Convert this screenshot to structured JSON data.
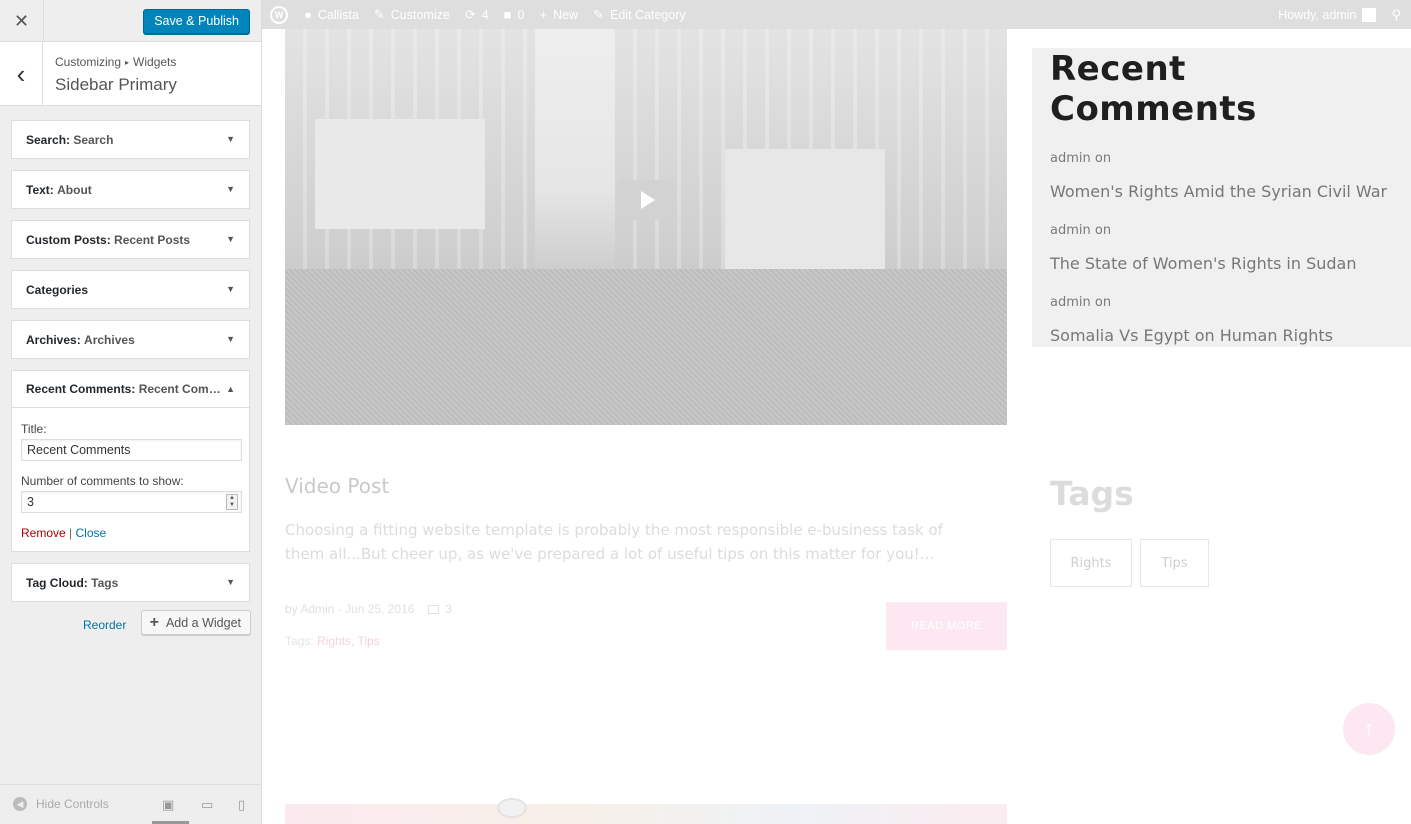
{
  "sidebar": {
    "close_glyph": "✕",
    "publish_label": "Save & Publish",
    "back_glyph": "‹",
    "breadcrumb": {
      "parent": "Customizing",
      "separator": "▸",
      "current": "Widgets"
    },
    "section_title": "Sidebar Primary",
    "widgets": [
      {
        "type": "Search",
        "instance": "Search",
        "open": false
      },
      {
        "type": "Text",
        "instance": "About",
        "open": false
      },
      {
        "type": "Custom Posts",
        "instance": "Recent Posts",
        "open": false
      },
      {
        "type": "Categories",
        "instance": "",
        "open": false
      },
      {
        "type": "Archives",
        "instance": "Archives",
        "open": false
      },
      {
        "type": "Recent Comments",
        "instance": "Recent Com…",
        "open": true
      },
      {
        "type": "Tag Cloud",
        "instance": "Tags",
        "open": false
      }
    ],
    "open_widget": {
      "title_label": "Title:",
      "title_value": "Recent Comments",
      "number_label": "Number of comments to show:",
      "number_value": "3",
      "remove_label": "Remove",
      "pipe": " | ",
      "close_label": "Close"
    },
    "reorder_label": "Reorder",
    "add_widget_label": "Add a Widget",
    "hide_controls_label": "Hide Controls",
    "device_icons": [
      "desktop-icon",
      "tablet-icon",
      "mobile-icon"
    ]
  },
  "adminbar": {
    "site_name": "Callista",
    "customize": "Customize",
    "updates": "4",
    "comments": "0",
    "new": "New",
    "edit": "Edit Category",
    "howdy": "Howdy, admin"
  },
  "preview": {
    "post_title": "Video Post",
    "post_excerpt": "Choosing a fitting website template is probably the most responsible e-business task of them all...But cheer up, as we've prepared a lot of useful tips on this matter for you!...",
    "post_meta": "by Admin - Jun 25, 2016",
    "post_comments": "3",
    "tags_prefix": "Tags: ",
    "tags_list": "Rights, Tips",
    "read_more": "READ MORE",
    "recent_comments_title": "Recent Comments",
    "recent_comments": [
      {
        "author": "admin on",
        "post": "Women's Rights Amid the Syrian Civil War"
      },
      {
        "author": "admin on",
        "post": "The State of Women's Rights in Sudan"
      },
      {
        "author": "admin on",
        "post": "Somalia Vs Egypt on Human Rights"
      }
    ],
    "tags_title": "Tags",
    "tags": [
      "Rights",
      "Tips"
    ]
  },
  "colors": {
    "accent": "#0085ba",
    "link": "#0073aa",
    "remove": "#aa0000",
    "pink_accent": "#fde7f1"
  }
}
